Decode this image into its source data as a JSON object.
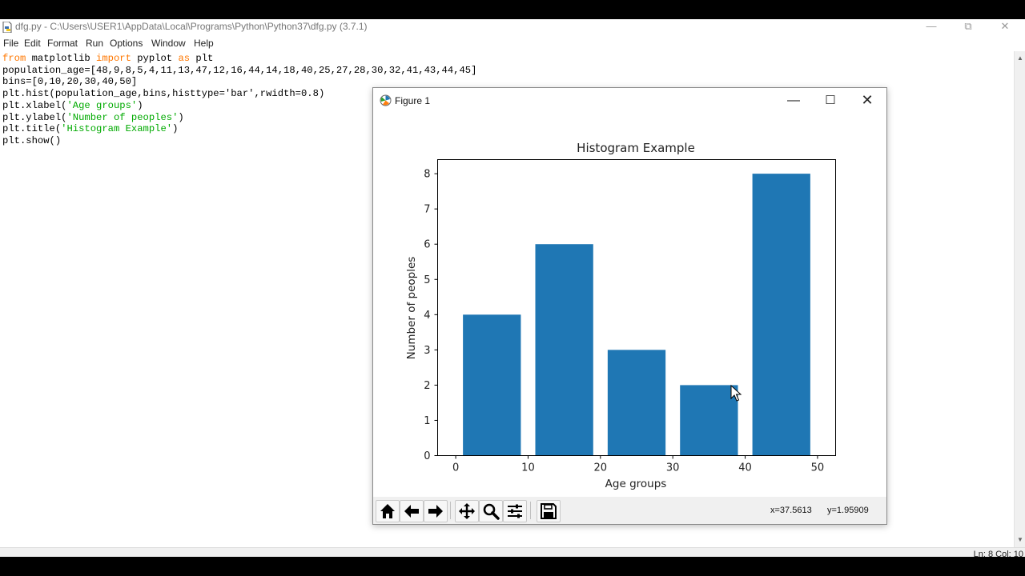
{
  "idle_window": {
    "title": "dfg.py - C:\\Users\\USER1\\AppData\\Local\\Programs\\Python\\Python37\\dfg.py (3.7.1)",
    "menu": [
      "File",
      "Edit",
      "Format",
      "Run",
      "Options",
      "Window",
      "Help"
    ],
    "status": "Ln: 8  Col: 10"
  },
  "code": {
    "line1": {
      "kw1": "from",
      "t1": " matplotlib ",
      "kw2": "import",
      "t2": " pyplot ",
      "kw3": "as",
      "t3": " plt"
    },
    "line2": "population_age=[48,9,8,5,4,11,13,47,12,16,44,14,18,40,25,27,28,30,32,41,43,44,45]",
    "line3": "bins=[0,10,20,30,40,50]",
    "line4": "plt.hist(population_age,bins,histtype='bar',rwidth=0.8)",
    "line5": {
      "a": "plt.xlabel(",
      "s": "'Age groups'",
      "b": ")"
    },
    "line6": {
      "a": "plt.ylabel(",
      "s": "'Number of peoples'",
      "b": ")"
    },
    "line7": {
      "a": "plt.title(",
      "s": "'Histogram Example'",
      "b": ")"
    },
    "line8": "plt.show()"
  },
  "figure_window": {
    "title": "Figure 1",
    "coord_x": "x=37.5613",
    "coord_y": "y=1.95909"
  },
  "icons": {
    "home": "home-icon",
    "back": "back-arrow-icon",
    "forward": "forward-arrow-icon",
    "pan": "pan-icon",
    "zoom": "zoom-icon",
    "configure": "subplots-config-icon",
    "save": "save-icon"
  },
  "colors": {
    "bar": "#1f77b4",
    "keyword": "#ff7700",
    "string": "#00aa00"
  },
  "chart_data": {
    "type": "bar",
    "title": "Histogram Example",
    "xlabel": "Age groups",
    "ylabel": "Number of peoples",
    "bins": [
      0,
      10,
      20,
      30,
      40,
      50
    ],
    "values": [
      4,
      6,
      3,
      2,
      8
    ],
    "rwidth": 0.8,
    "xlim": [
      -2.5,
      52.5
    ],
    "ylim": [
      0,
      8.4
    ],
    "xticks": [
      0,
      10,
      20,
      30,
      40,
      50
    ],
    "yticks": [
      0,
      1,
      2,
      3,
      4,
      5,
      6,
      7,
      8
    ],
    "grid": false,
    "legend": false
  }
}
